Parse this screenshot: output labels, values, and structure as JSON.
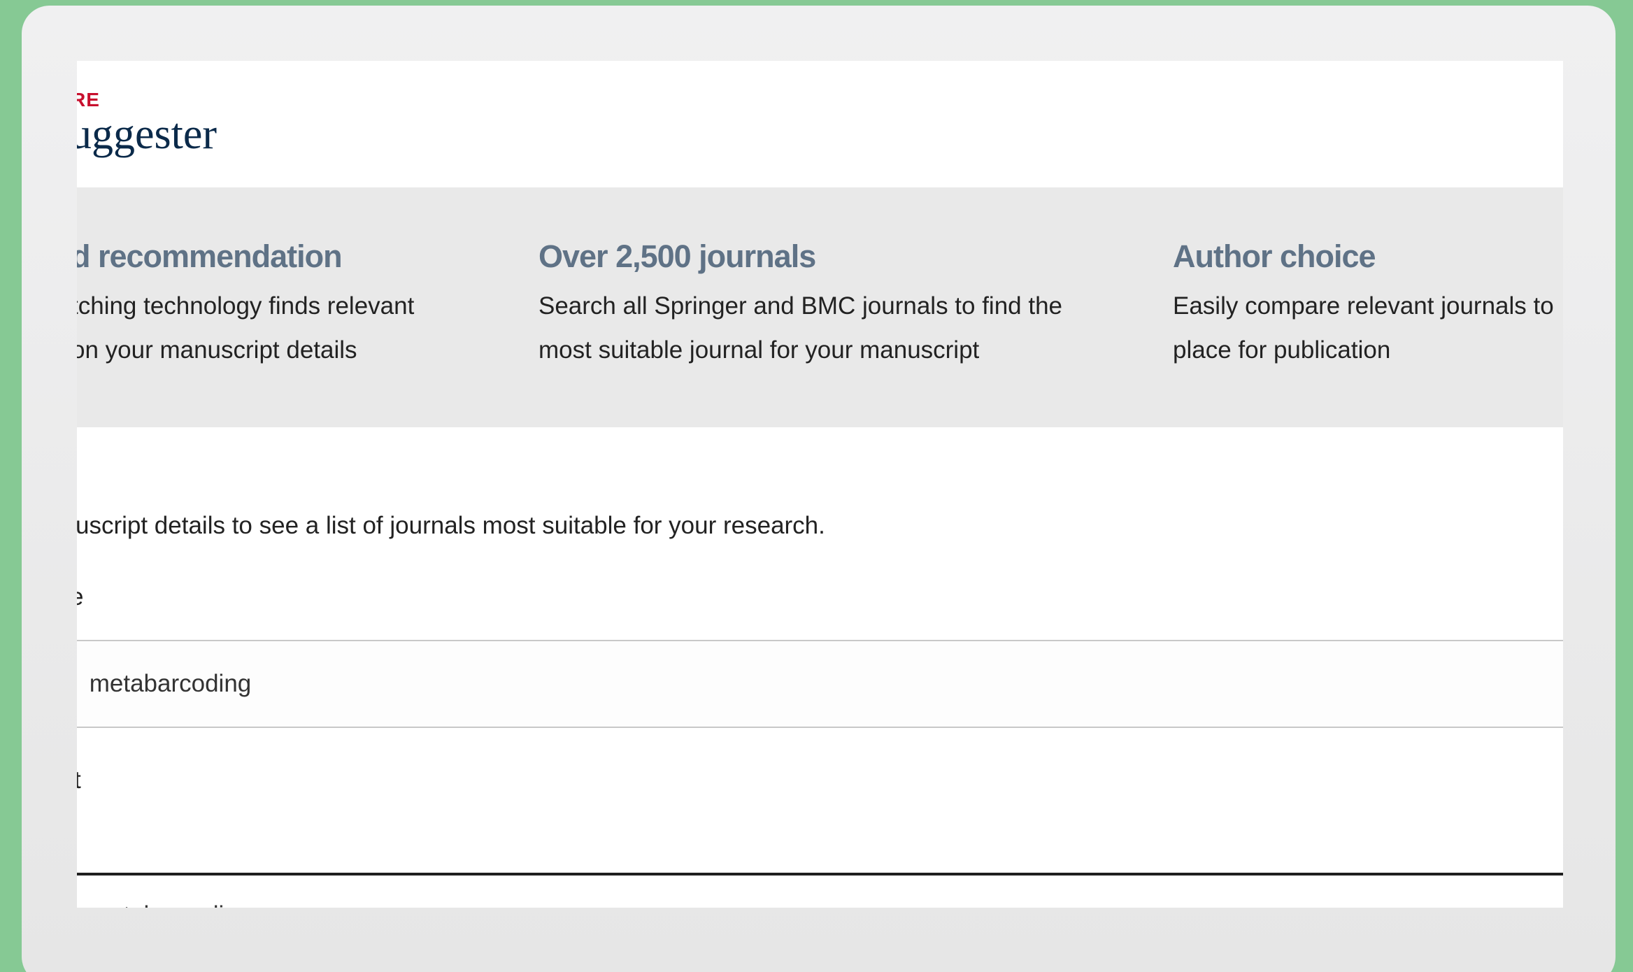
{
  "header": {
    "brand_kicker": "RE",
    "brand_title": "uggester"
  },
  "features": [
    {
      "title": "d recommendation",
      "desc_line1": "tching technology finds relevant",
      "desc_line2": " on your manuscript details"
    },
    {
      "title": "Over 2,500 journals",
      "desc_line1": "Search all Springer and BMC journals to find the",
      "desc_line2": "most suitable journal for your manuscript"
    },
    {
      "title": "Author choice",
      "desc_line1": "Easily compare relevant journals to",
      "desc_line2": "place for publication"
    }
  ],
  "form": {
    "intro": "uscript details to see a list of journals most suitable for your research.",
    "title_label": "e",
    "title_value": " metabarcoding",
    "abstract_label": "t",
    "abstract_value": " metabarcoding"
  },
  "colors": {
    "background_green": "#86c994",
    "brand_red": "#c8102e",
    "brand_navy": "#0b2a4a",
    "feature_title": "#5f7286",
    "feature_band": "#e9e9e9"
  }
}
